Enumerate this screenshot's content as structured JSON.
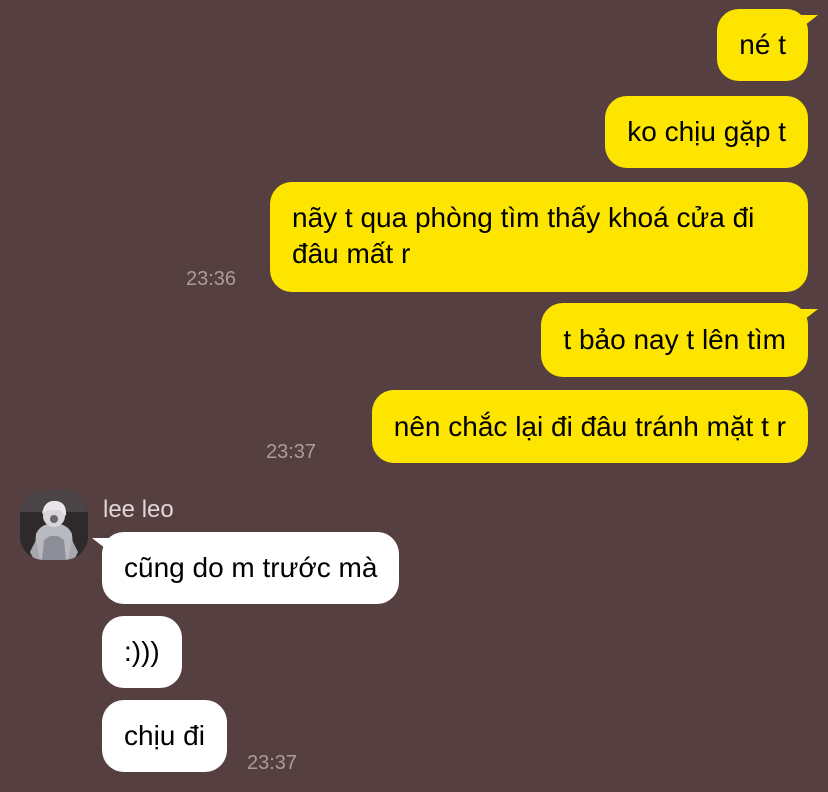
{
  "chat": {
    "outgoing": [
      {
        "text": "né t"
      },
      {
        "text": "ko chịu gặp t"
      },
      {
        "line1": "nãy t qua phòng tìm thấy khoá cửa đi",
        "line2": "đâu mất r",
        "time": "23:36"
      },
      {
        "text": "t bảo nay t lên tìm"
      },
      {
        "text": "nên chắc lại đi đâu tránh mặt t r",
        "time": "23:37"
      }
    ],
    "incoming": {
      "sender_name": "lee leo",
      "avatar_icon": "user-avatar-photo",
      "messages": [
        {
          "text": "cũng do m trước mà"
        },
        {
          "text": ":)))"
        },
        {
          "text": "chịu đi",
          "time": "23:37"
        }
      ]
    }
  },
  "colors": {
    "background": "#553F40",
    "outgoing_bubble": "#FEE500",
    "incoming_bubble": "#FFFFFF",
    "timestamp": "#A99C9A"
  }
}
